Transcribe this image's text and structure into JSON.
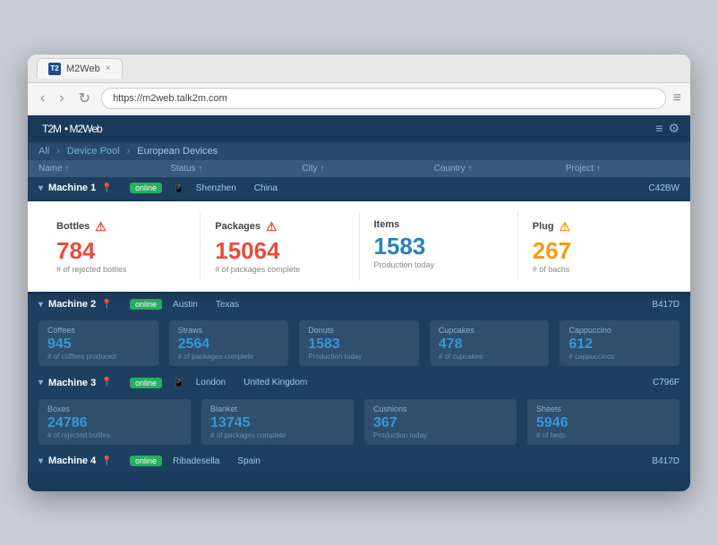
{
  "browser": {
    "tab_favicon": "T2",
    "tab_title": "M2Web",
    "tab_close": "×",
    "back_btn": "‹",
    "forward_btn": "›",
    "refresh_btn": "↻",
    "address": "https://m2web.talk2m.com",
    "menu_icon": "≡"
  },
  "app": {
    "logo": "T2M",
    "logo_sub": "• M2Web",
    "header_icons": [
      "≡",
      "⚙"
    ]
  },
  "breadcrumb": {
    "items": [
      "All",
      "Device Pool",
      "European Devices"
    ]
  },
  "table_header": {
    "name": "Name ↑",
    "status": "Status ↑",
    "city": "City ↑",
    "country": "Country ↑",
    "project": "Project ↑"
  },
  "machine1": {
    "label": "Machine 1",
    "pin": "📍",
    "status": "online",
    "phone_icon": "📱",
    "city": "Shenzhen",
    "country": "China",
    "project": "C42BW",
    "metrics": [
      {
        "title": "Bottles",
        "alert": "⚠",
        "alert_class": "alert-red",
        "value": "784",
        "value_class": "red",
        "sub": "# of rejected bottles"
      },
      {
        "title": "Packages",
        "alert": "⚠",
        "alert_class": "alert-red",
        "value": "15064",
        "value_class": "red",
        "sub": "# of packages complete"
      },
      {
        "title": "Items",
        "alert": "",
        "alert_class": "",
        "value": "1583",
        "value_class": "blue",
        "sub": "Production today"
      },
      {
        "title": "Plug",
        "alert": "⚠",
        "alert_class": "alert-orange",
        "value": "267",
        "value_class": "orange",
        "sub": "# of bachs"
      }
    ]
  },
  "machine2": {
    "label": "Machine 2",
    "pin": "📍",
    "status": "online",
    "city": "Austin",
    "state": "Texas",
    "project": "B417D",
    "metrics": [
      {
        "title": "Coffees",
        "value": "945",
        "sub": "# of coffees produced"
      },
      {
        "title": "Straws",
        "value": "2564",
        "sub": "# of packages complete"
      },
      {
        "title": "Donuts",
        "value": "1583",
        "sub": "Production today"
      },
      {
        "title": "Cupcakes",
        "value": "478",
        "sub": "# of cupcakes"
      },
      {
        "title": "Cappuccino",
        "value": "612",
        "sub": "# cappuccinos"
      }
    ]
  },
  "machine3": {
    "label": "Machine 3",
    "pin": "📍",
    "status": "online",
    "phone_icon": "📱",
    "city": "London",
    "country": "United Kingdom",
    "project": "C796F",
    "metrics": [
      {
        "title": "Boxes",
        "value": "24786",
        "sub": "# of rejected bottles"
      },
      {
        "title": "Blanket",
        "value": "13745",
        "sub": "# of packages complete"
      },
      {
        "title": "Cushions",
        "value": "367",
        "sub": "Production today"
      },
      {
        "title": "Sheets",
        "value": "5946",
        "sub": "# of beds"
      }
    ]
  },
  "machine4": {
    "label": "Machine 4",
    "pin": "📍",
    "status": "online",
    "city": "Ribadesella",
    "country": "Spain",
    "project": "B417D"
  }
}
